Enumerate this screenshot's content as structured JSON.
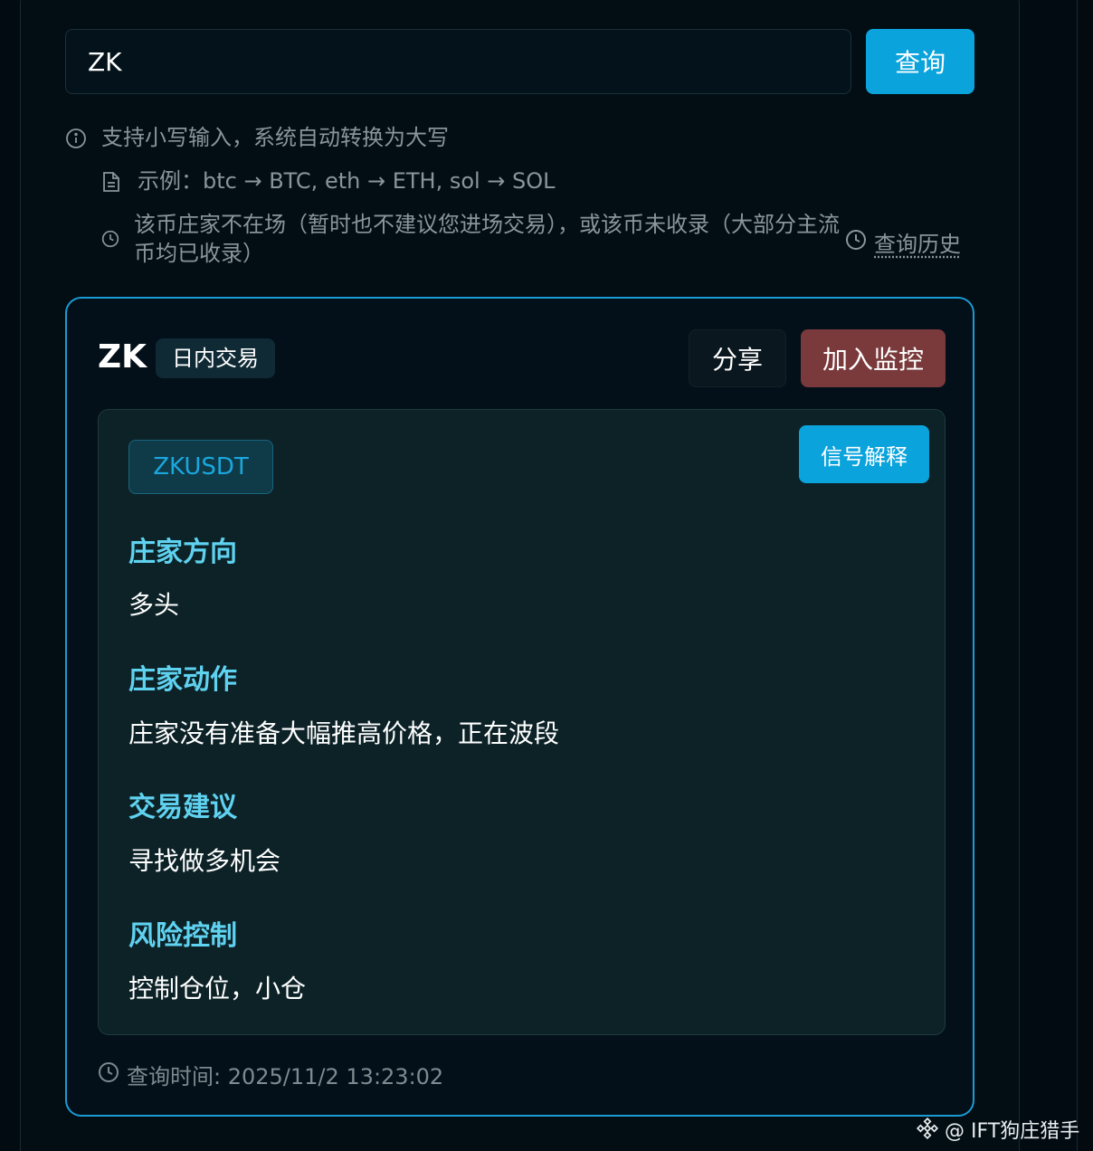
{
  "search": {
    "value": "ZK",
    "button_label": "查询"
  },
  "hints": {
    "line1": "支持小写输入，系统自动转换为大写",
    "line2": "示例：btc → BTC, eth → ETH, sol → SOL",
    "line3": "该币庄家不在场（暂时也不建议您进场交易），或该币未收录（大部分主流币均已收录）",
    "history_label": "查询历史"
  },
  "result": {
    "symbol": "ZK",
    "tag": "日内交易",
    "share_label": "分享",
    "monitor_label": "加入监控",
    "pair": "ZKUSDT",
    "explain_label": "信号解释",
    "sections": [
      {
        "title": "庄家方向",
        "body": "多头"
      },
      {
        "title": "庄家动作",
        "body": "庄家没有准备大幅推高价格，正在波段"
      },
      {
        "title": "交易建议",
        "body": "寻找做多机会"
      },
      {
        "title": "风险控制",
        "body": "控制仓位，小仓"
      }
    ],
    "query_time": "查询时间: 2025/11/2 13:23:02"
  },
  "watermark": "@ IFT狗庄猎手",
  "colors": {
    "accent": "#0aa3dc",
    "section_title": "#5fd2f0",
    "monitor_button": "#7a3a3c",
    "card_border": "#1b9bd4"
  }
}
